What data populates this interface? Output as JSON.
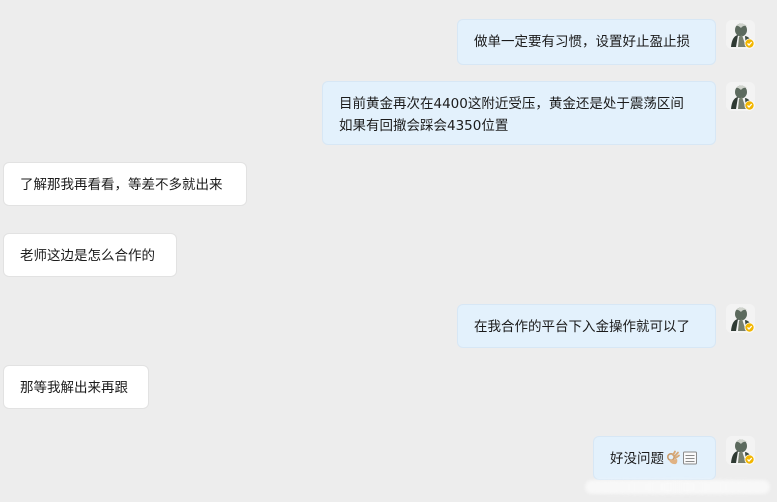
{
  "colors": {
    "background": "#ededed",
    "outgoing_bubble": "#e3f1fc",
    "incoming_bubble": "#ffffff",
    "avatar_badge": "#f2b600"
  },
  "messages": [
    {
      "direction": "out",
      "lines": [
        "做单一定要有习惯，设置好止盈止损"
      ]
    },
    {
      "direction": "out",
      "lines": [
        "目前黄金再次在4400这附近受压，黄金还是处于震荡区间",
        "如果有回撤会踩会4350位置"
      ]
    },
    {
      "direction": "in",
      "lines": [
        "了解那我再看看，等差不多就出来"
      ]
    },
    {
      "direction": "in",
      "lines": [
        "老师这边是怎么合作的"
      ]
    },
    {
      "direction": "out",
      "lines": [
        "在我合作的平台下入金操作就可以了"
      ]
    },
    {
      "direction": "in",
      "lines": [
        "那等我解出来再跟"
      ]
    },
    {
      "direction": "out",
      "lines": [
        "好没问题"
      ],
      "trailing_icons": [
        "ok-hand-emoji-icon",
        "document-icon"
      ]
    }
  ],
  "avatar_icon": "user-avatar-icon"
}
